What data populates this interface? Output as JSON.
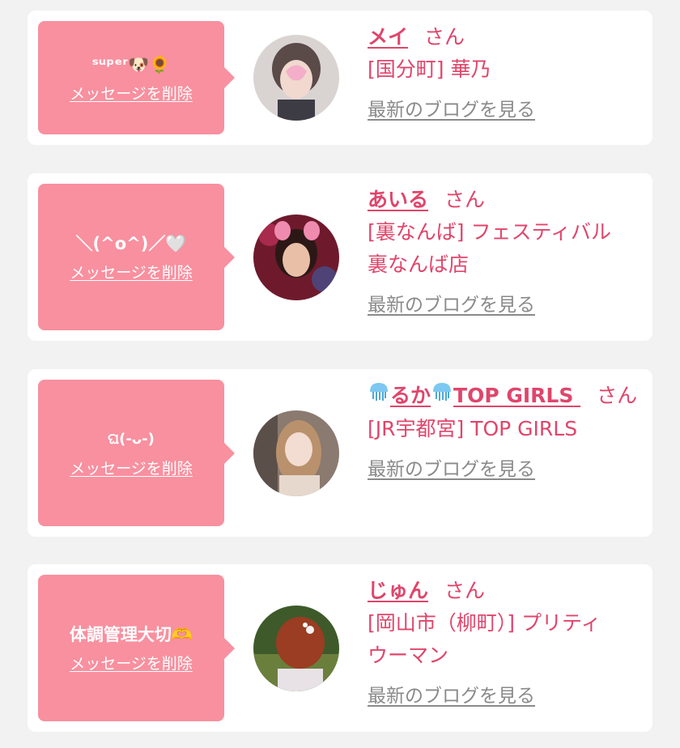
{
  "colors": {
    "bubble": "#f8909f",
    "accent": "#e0456b",
    "link_gray": "#8a8a8a",
    "page_bg": "#f2f2f2",
    "card_bg": "#ffffff"
  },
  "delete_label": "メッセージを削除",
  "honorific": "さん",
  "blog_label": "最新のブログを見る",
  "messages": [
    {
      "message": "ˢᵘᵖᵉʳ🐶🌻",
      "name": "メイ",
      "shop": "[国分町] 華乃"
    },
    {
      "message": "＼(^o^)／🤍",
      "name": "あいる",
      "shop_line1": "[裏なんば] フェスティバル",
      "shop_line2": "裏なんば店"
    },
    {
      "message": "ଘ(-ᴗ-)",
      "name_prefix_icon": "jellyfish-icon",
      "name": "るか",
      "name_suffix": "TOP GIRLS",
      "shop": "[JR宇都宮] TOP GIRLS"
    },
    {
      "message": "体調管理大切🫶",
      "name": "じゅん",
      "shop_line1": "[岡山市（柳町）] プリティ",
      "shop_line2": "ウーマン"
    }
  ]
}
